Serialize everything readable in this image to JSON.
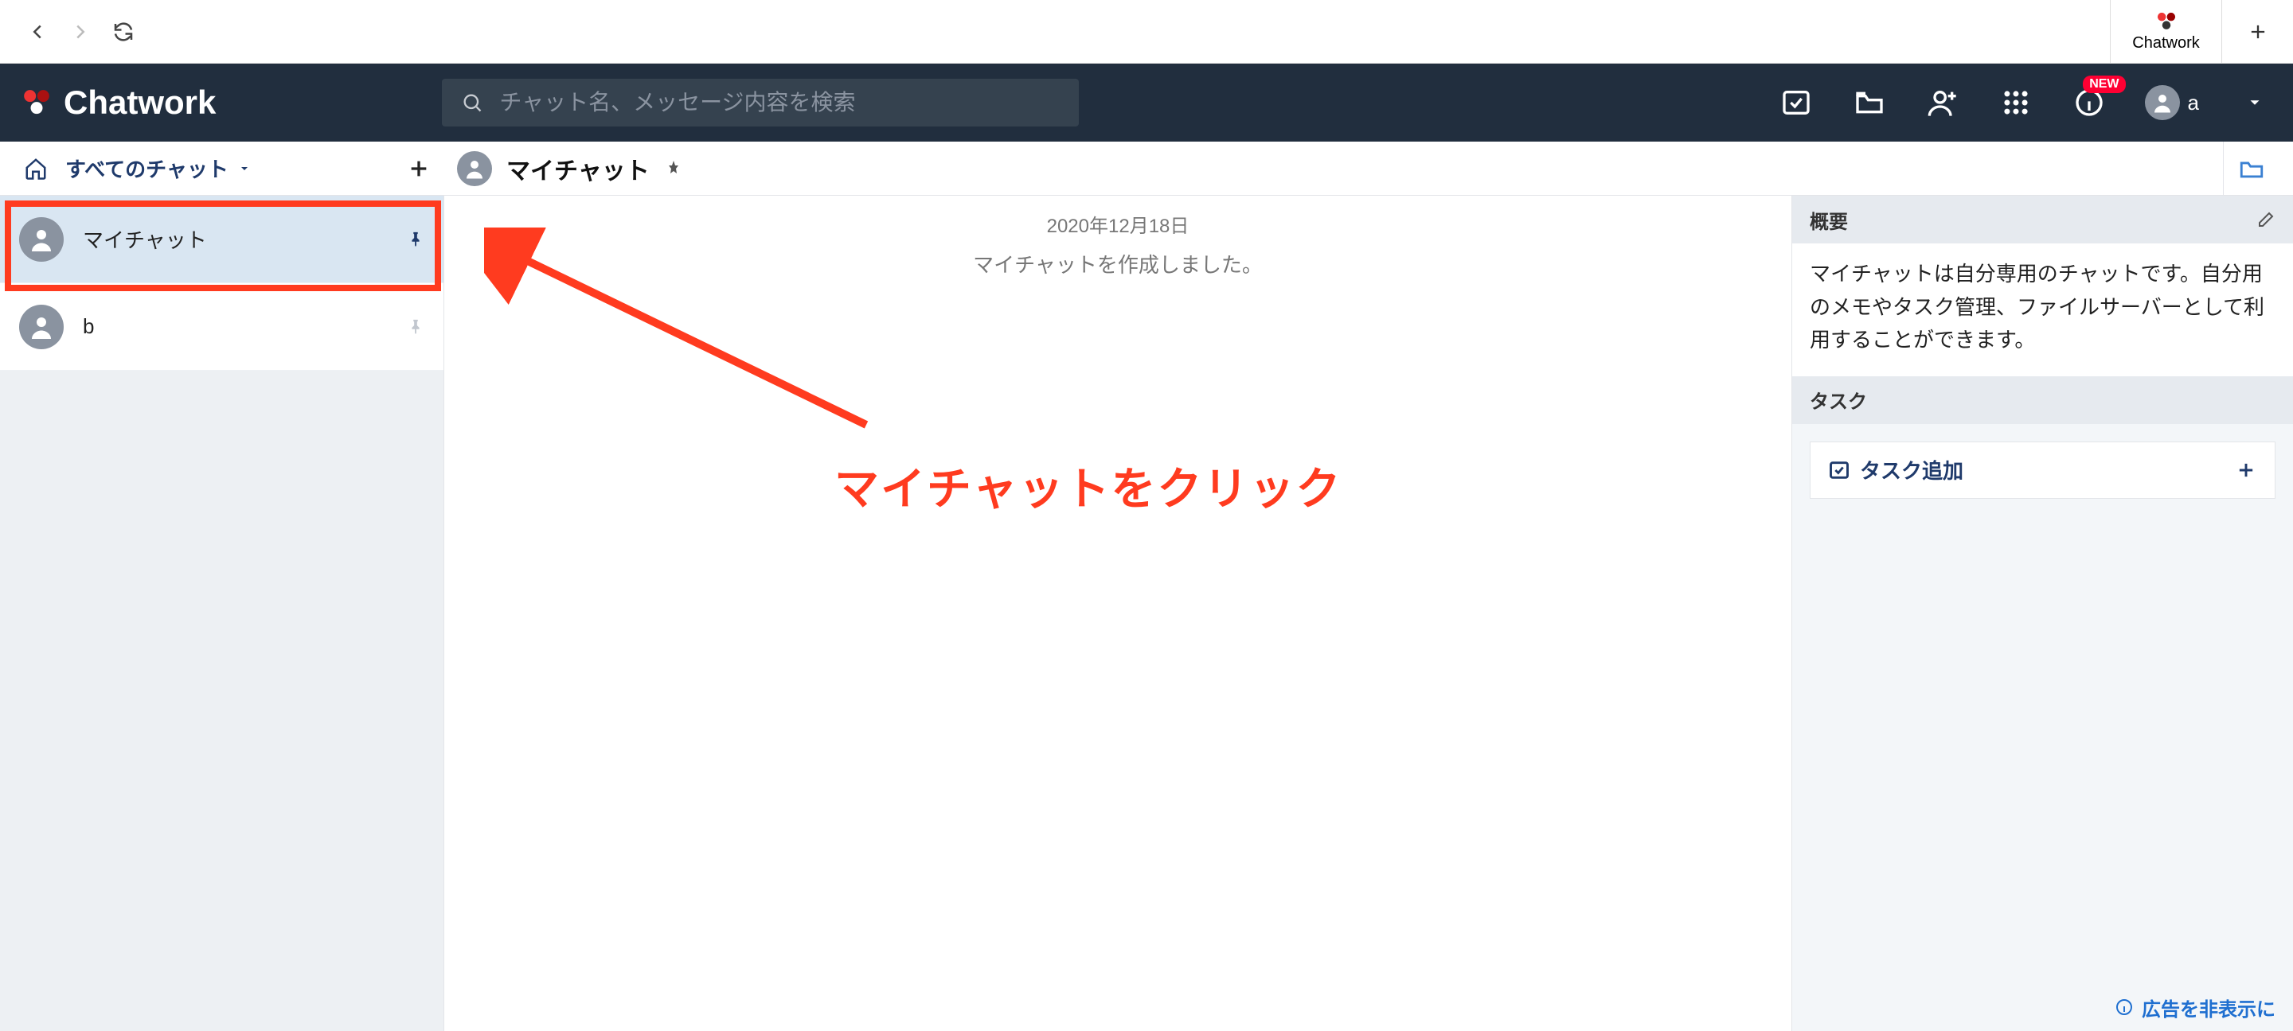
{
  "browser": {
    "tab_label": "Chatwork"
  },
  "header": {
    "brand": "Chatwork",
    "search_placeholder": "チャット名、メッセージ内容を検索",
    "new_badge": "NEW",
    "user_initial": "a"
  },
  "subheader": {
    "filter_label": "すべてのチャット",
    "room_title": "マイチャット"
  },
  "sidebar": {
    "rooms": [
      {
        "name": "マイチャット",
        "pinned": true,
        "selected": true
      },
      {
        "name": "b",
        "pinned": false,
        "selected": false
      }
    ]
  },
  "chat": {
    "date": "2020年12月18日",
    "system_msg": "マイチャットを作成しました。"
  },
  "annotation": {
    "text": "マイチャットをクリック"
  },
  "right": {
    "overview_header": "概要",
    "overview_text": "マイチャットは自分専用のチャットです。自分用のメモやタスク管理、ファイルサーバーとして利用することができます。",
    "task_header": "タスク",
    "task_add_label": "タスク追加",
    "ad_hide": "広告を非表示に"
  }
}
